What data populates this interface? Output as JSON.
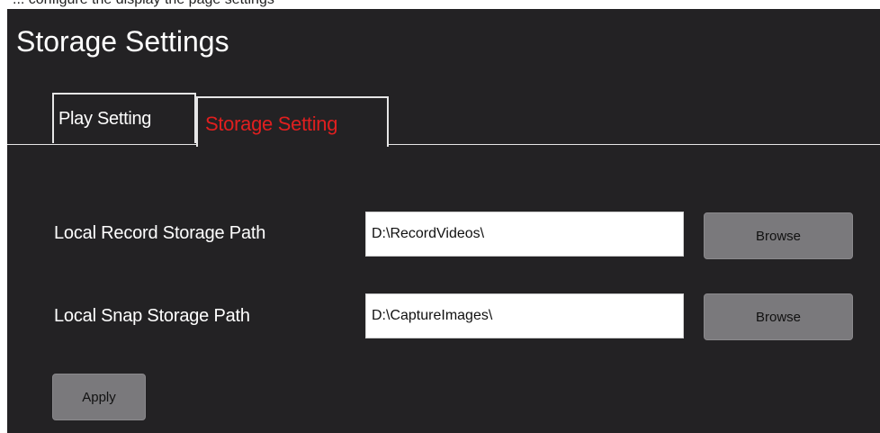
{
  "caption": "... configure the display the page settings",
  "window": {
    "title": "Storage Settings"
  },
  "tabs": [
    {
      "label": "Play Setting",
      "active": false
    },
    {
      "label": "Storage Setting",
      "active": true
    }
  ],
  "form": {
    "record": {
      "label": "Local Record Storage Path",
      "value": "D:\\RecordVideos\\",
      "browse_label": "Browse"
    },
    "snap": {
      "label": "Local Snap Storage Path",
      "value": "D:\\CaptureImages\\",
      "browse_label": "Browse"
    },
    "apply_label": "Apply"
  },
  "colors": {
    "panel_background": "#232224",
    "active_tab_text": "#e01f1f",
    "button_background": "#7a797c"
  }
}
